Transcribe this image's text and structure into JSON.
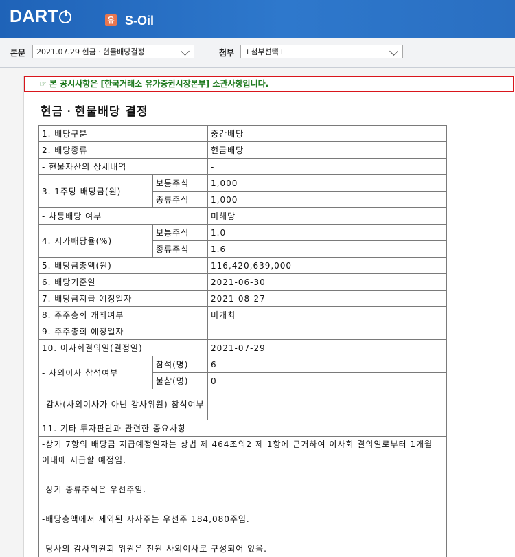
{
  "header": {
    "logo_text": "DART",
    "corp_badge": "유",
    "corp_name": "S-Oil"
  },
  "toolbar": {
    "body_label": "본문",
    "body_select": "2021.07.29  현금ㆍ현물배당결정",
    "attach_label": "첨부",
    "attach_select": "+첨부선택+"
  },
  "notice": "☞ 본 공시사항은 [한국거래소 유가증권시장본부] 소관사항입니다.",
  "title": "현금ㆍ현물배당 결정",
  "rows": {
    "r1": {
      "label": "1. 배당구분",
      "value": "중간배당"
    },
    "r2": {
      "label": "2. 배당종류",
      "value": "현금배당"
    },
    "r2a": {
      "label": "- 현물자산의 상세내역",
      "value": "-"
    },
    "r3": {
      "label": "3. 1주당 배당금(원)",
      "sub1": "보통주식",
      "val1": "1,000",
      "sub2": "종류주식",
      "val2": "1,000"
    },
    "r3a": {
      "label": "- 차등배당 여부",
      "value": "미해당"
    },
    "r4": {
      "label": "4. 시가배당율(%)",
      "sub1": "보통주식",
      "val1": "1.0",
      "sub2": "종류주식",
      "val2": "1.6"
    },
    "r5": {
      "label": "5. 배당금총액(원)",
      "value": "116,420,639,000"
    },
    "r6": {
      "label": "6. 배당기준일",
      "value": "2021-06-30"
    },
    "r7": {
      "label": "7. 배당금지급 예정일자",
      "value": "2021-08-27"
    },
    "r8": {
      "label": "8. 주주총회 개최여부",
      "value": "미개최"
    },
    "r9": {
      "label": "9. 주주총회 예정일자",
      "value": "-"
    },
    "r10": {
      "label": "10. 이사회결의일(결정일)",
      "value": "2021-07-29"
    },
    "r10a": {
      "label": "- 사외이사 참석여부",
      "sub1": "참석(명)",
      "val1": "6",
      "sub2": "불참(명)",
      "val2": "0"
    },
    "r10b": {
      "label": "- 감사(사외이사가 아닌 감사위원) 참석여부",
      "value": "-"
    },
    "r11": {
      "label": "11. 기타 투자판단과 관련한 중요사항"
    }
  },
  "notes": [
    "-상기 7항의 배당금 지급예정일자는 상법 제 464조의2 제 1항에 근거하여 이사회 결의일로부터 1개월 이내에 지급할 예정임.",
    "-상기 종류주식은 우선주임.",
    "-배당총액에서 제외된 자사주는 우선주 184,080주임.",
    "-당사의 감사위원회 위원은 전원 사외이사로 구성되어 있음."
  ]
}
